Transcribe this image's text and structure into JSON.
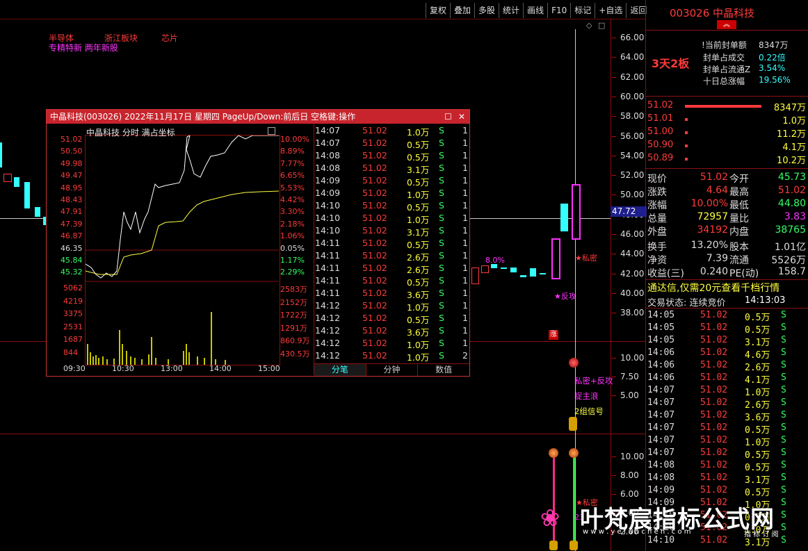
{
  "toolbar": [
    "复权",
    "叠加",
    "多股",
    "统计",
    "画线",
    "F10",
    "标记",
    "+自选",
    "返回"
  ],
  "stock_header": {
    "code_name": "003026 中晶科技",
    "boards": "3天2板"
  },
  "concepts": {
    "c1": "半导体",
    "c2": "浙江板块",
    "c3": "芯片",
    "c4": "专精特新 两年新股"
  },
  "price_axis": [
    "66.00",
    "64.00",
    "62.00",
    "60.00",
    "58.00",
    "56.00",
    "54.00",
    "52.00",
    "50.00",
    "48.00",
    "46.00",
    "44.00",
    "42.00",
    "40.00",
    "38.00"
  ],
  "crosshair_price": "47.72",
  "chart_labels": {
    "pct": "8.0%",
    "simi": "★私密",
    "fangong": "★反攻",
    "zhang": "涨"
  },
  "vol_axis": [
    "10.00",
    "7.50",
    "5.00"
  ],
  "vol_labels": {
    "l1": "私密+反攻",
    "l2": "捉主浪",
    "l3": "2组信号"
  },
  "ind_axis": [
    "10.00",
    "8.00",
    "6.00",
    "4.00",
    "2.00"
  ],
  "ind_labels": {
    "l1": "★私密",
    "l2": "23"
  },
  "popup": {
    "title": "中晶科技(003026) 2022年11月17日 星期四 PageUp/Down:前后日 空格键:操作",
    "chart_title": "中晶科技  分时 满占坐标",
    "prices": [
      "51.02",
      "50.50",
      "49.98",
      "49.47",
      "48.95",
      "48.43",
      "47.91",
      "47.39",
      "46.87",
      "46.35",
      "45.84",
      "45.32"
    ],
    "pcts": [
      "10.00%",
      "8.89%",
      "7.77%",
      "6.65%",
      "5.53%",
      "4.42%",
      "3.30%",
      "2.18%",
      "1.06%",
      "0.05%",
      "1.17%",
      "2.29%"
    ],
    "vols": [
      "5062",
      "4219",
      "3375",
      "2531",
      "1687",
      "844"
    ],
    "vol_r": [
      "2583万",
      "2152万",
      "1722万",
      "1291万",
      "860.9万",
      "430.5万"
    ],
    "times": [
      "09:30",
      "10:30",
      "13:00",
      "14:00",
      "15:00"
    ],
    "ticks": [
      [
        "14:07",
        "51.02",
        "1.0万",
        "S",
        "1"
      ],
      [
        "14:07",
        "51.02",
        "0.5万",
        "S",
        "1"
      ],
      [
        "14:08",
        "51.02",
        "0.5万",
        "S",
        "1"
      ],
      [
        "14:08",
        "51.02",
        "3.1万",
        "S",
        "1"
      ],
      [
        "14:09",
        "51.02",
        "0.5万",
        "S",
        "1"
      ],
      [
        "14:09",
        "51.02",
        "1.0万",
        "S",
        "1"
      ],
      [
        "14:10",
        "51.02",
        "0.5万",
        "S",
        "1"
      ],
      [
        "14:10",
        "51.02",
        "1.0万",
        "S",
        "1"
      ],
      [
        "14:10",
        "51.02",
        "3.1万",
        "S",
        "1"
      ],
      [
        "14:11",
        "51.02",
        "0.5万",
        "S",
        "1"
      ],
      [
        "14:11",
        "51.02",
        "2.6万",
        "S",
        "1"
      ],
      [
        "14:11",
        "51.02",
        "2.6万",
        "S",
        "1"
      ],
      [
        "14:11",
        "51.02",
        "0.5万",
        "S",
        "1"
      ],
      [
        "14:11",
        "51.02",
        "3.6万",
        "S",
        "1"
      ],
      [
        "14:12",
        "51.02",
        "1.0万",
        "S",
        "1"
      ],
      [
        "14:12",
        "51.02",
        "0.5万",
        "S",
        "1"
      ],
      [
        "14:12",
        "51.02",
        "3.6万",
        "S",
        "1"
      ],
      [
        "14:12",
        "51.02",
        "1.0万",
        "S",
        "1"
      ],
      [
        "14:12",
        "51.02",
        "1.0万",
        "S",
        "2"
      ]
    ],
    "tabs": [
      "分笔",
      "分钟",
      "数值"
    ]
  },
  "seal": {
    "r1l": "当前封单额",
    "r1v": "8347万",
    "r2l": "封单占成交",
    "r2v": "0.22倍",
    "r3l": "封单占流通Z",
    "r3v": "3.54%",
    "r4l": "十日总涨幅",
    "r4v": "19.56%"
  },
  "bids": [
    {
      "p": "51.02",
      "v": "8347万"
    },
    {
      "p": "51.01",
      "v": "1.0万"
    },
    {
      "p": "51.00",
      "v": "11.2万"
    },
    {
      "p": "50.90",
      "v": "4.1万"
    },
    {
      "p": "50.89",
      "v": "10.2万"
    }
  ],
  "quote": [
    [
      "现价",
      "51.02",
      "今开",
      "45.73"
    ],
    [
      "涨跌",
      "4.64",
      "最高",
      "51.02"
    ],
    [
      "涨幅",
      "10.00%",
      "最低",
      "44.80"
    ],
    [
      "总量",
      "72957",
      "量比",
      "3.83"
    ],
    [
      "外盘",
      "34192",
      "内盘",
      "38765"
    ],
    [
      "换手",
      "13.20%",
      "股本",
      "1.01亿"
    ],
    [
      "净资",
      "7.39",
      "流通",
      "5526万"
    ],
    [
      "收益(三)",
      "0.240",
      "PE(动)",
      "158.7"
    ]
  ],
  "promo": "通达信,仅需20元查看千档行情",
  "trade_status": {
    "label": "交易状态: 连续竞价",
    "time": "14:13:03"
  },
  "rticks": [
    [
      "14:05",
      "51.02",
      "0.5万",
      "S"
    ],
    [
      "14:05",
      "51.02",
      "0.5万",
      "S"
    ],
    [
      "14:05",
      "51.02",
      "3.1万",
      "S"
    ],
    [
      "14:06",
      "51.02",
      "4.6万",
      "S"
    ],
    [
      "14:06",
      "51.02",
      "2.6万",
      "S"
    ],
    [
      "14:06",
      "51.02",
      "4.1万",
      "S"
    ],
    [
      "14:07",
      "51.02",
      "1.0万",
      "S"
    ],
    [
      "14:07",
      "51.02",
      "2.6万",
      "S"
    ],
    [
      "14:07",
      "51.02",
      "3.6万",
      "S"
    ],
    [
      "14:07",
      "51.02",
      "0.5万",
      "S"
    ],
    [
      "14:07",
      "51.02",
      "1.0万",
      "S"
    ],
    [
      "14:07",
      "51.02",
      "0.5万",
      "S"
    ],
    [
      "14:08",
      "51.02",
      "0.5万",
      "S"
    ],
    [
      "14:08",
      "51.02",
      "3.1万",
      "S"
    ],
    [
      "14:09",
      "51.02",
      "0.5万",
      "S"
    ],
    [
      "14:09",
      "51.02",
      "1.0万",
      "S"
    ],
    [
      "14:10",
      "51.02",
      "0.5万",
      "S"
    ],
    [
      "14:10",
      "51.02",
      "1.0万",
      "S"
    ],
    [
      "14:10",
      "51.02",
      "3.1万",
      "S"
    ]
  ],
  "watermark": {
    "text": "叶梵宸指标公式网",
    "sub": "w w w . y e f a n c h e n . c o m",
    "sub2": "指 标 订 阅"
  }
}
